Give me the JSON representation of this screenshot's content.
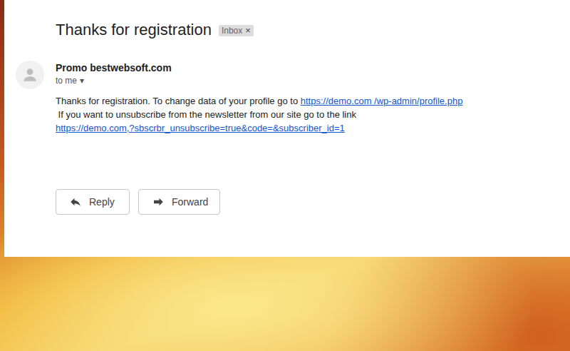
{
  "email": {
    "subject": "Thanks for registration",
    "label": {
      "text": "Inbox",
      "close": "×"
    },
    "sender": "Promo bestwebsoft.com",
    "recipient": "to me",
    "recipient_caret": "▾",
    "body": [
      [
        {
          "kind": "text",
          "text": "Thanks for registration. To change data of your profile go to "
        },
        {
          "kind": "link",
          "text": "https://demo.com /wp-admin/profile.php"
        }
      ],
      [
        {
          "kind": "text",
          "text": " If you want to unsubscribe from the newsletter from our site go to the link"
        }
      ],
      [
        {
          "kind": "link",
          "text": "https://demo.com,?sbscrbr_unsubscribe=true&code=&subscriber_id=1"
        }
      ]
    ]
  },
  "buttons": [
    {
      "label": "Reply",
      "kind": "reply"
    },
    {
      "label": "Forward",
      "kind": "forward"
    }
  ]
}
